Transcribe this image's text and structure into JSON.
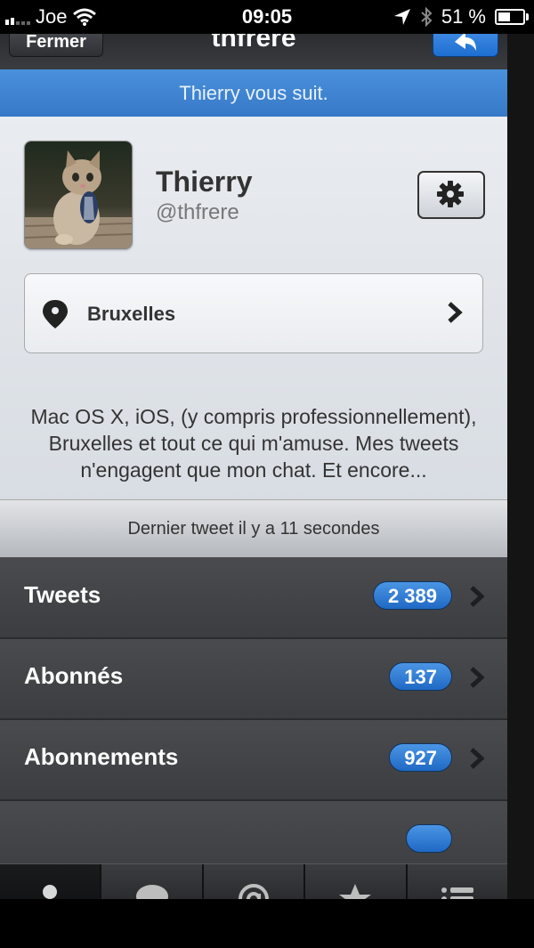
{
  "statusbar": {
    "carrier": "Joe",
    "time": "09:05",
    "battery_percent": "51 %",
    "battery_level": 0.51
  },
  "navbar": {
    "left_button": "Fermer",
    "title": "thfrere"
  },
  "banner": {
    "text": "Thierry vous suit."
  },
  "profile": {
    "name": "Thierry",
    "handle": "@thfrere",
    "location": "Bruxelles",
    "bio": "Mac OS X, iOS, (y compris professionnellement), Bruxelles et tout ce qui m'amuse. Mes tweets n'engagent que mon chat. Et encore..."
  },
  "last_tweet": "Dernier tweet il y a 11 secondes",
  "stats": [
    {
      "label": "Tweets",
      "count": "2 389"
    },
    {
      "label": "Abonnés",
      "count": "137"
    },
    {
      "label": "Abonnements",
      "count": "927"
    }
  ],
  "tabs": [
    {
      "icon": "person-icon",
      "active": true
    },
    {
      "icon": "speech-bubble-icon",
      "active": false
    },
    {
      "icon": "at-sign-icon",
      "active": false
    },
    {
      "icon": "star-icon",
      "active": false
    },
    {
      "icon": "list-icon",
      "active": false
    }
  ],
  "colors": {
    "accent_blue": "#3679c8",
    "count_badge": "#1f69c4"
  }
}
